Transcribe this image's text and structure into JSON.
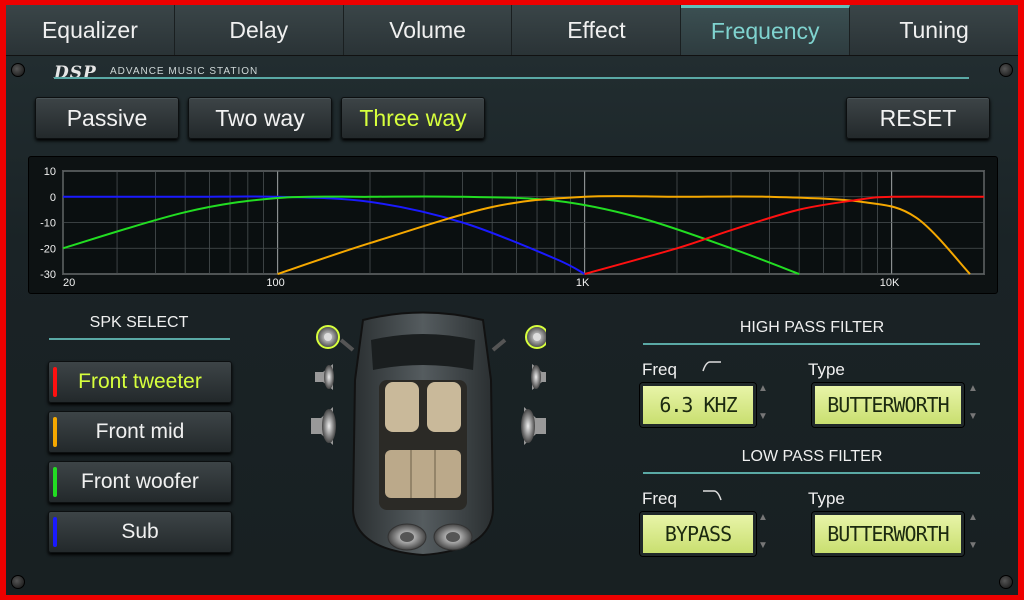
{
  "tabs": [
    {
      "label": "Equalizer",
      "active": false
    },
    {
      "label": "Delay",
      "active": false
    },
    {
      "label": "Volume",
      "active": false
    },
    {
      "label": "Effect",
      "active": false
    },
    {
      "label": "Frequency",
      "active": true
    },
    {
      "label": "Tuning",
      "active": false
    }
  ],
  "header": {
    "logo": "DSP",
    "subtitle": "ADVANCE MUSIC STATION"
  },
  "mode_buttons": {
    "passive": "Passive",
    "two_way": "Two way",
    "three_way": "Three way",
    "active": "three_way",
    "reset": "RESET"
  },
  "graph": {
    "y_ticks": [
      "10",
      "0",
      "-10",
      "-20",
      "-30"
    ],
    "x_ticks": [
      "20",
      "100",
      "1K",
      "10K"
    ]
  },
  "chart_data": {
    "type": "line",
    "x_scale": "log",
    "xlim": [
      20,
      20000
    ],
    "ylim": [
      -30,
      10
    ],
    "series": [
      {
        "color": "#1a1aff",
        "x": [
          20,
          50,
          100,
          200,
          400,
          800,
          1000
        ],
        "y": [
          0,
          0,
          0,
          -2,
          -10,
          -24,
          -30
        ]
      },
      {
        "color": "#22dd22",
        "x": [
          20,
          50,
          100,
          200,
          400,
          800,
          1500,
          3000,
          5000
        ],
        "y": [
          -20,
          -6,
          -0.5,
          0,
          0,
          -1.5,
          -8,
          -20,
          -30
        ]
      },
      {
        "color": "#f5a800",
        "x": [
          100,
          200,
          500,
          1000,
          2000,
          4000,
          8000,
          12000,
          18000
        ],
        "y": [
          -30,
          -18,
          -4,
          0,
          0,
          0,
          -2,
          -8,
          -30
        ]
      },
      {
        "color": "#ff1010",
        "x": [
          1000,
          2000,
          3000,
          5000,
          8000,
          10000,
          20000
        ],
        "y": [
          -30,
          -20,
          -13,
          -5,
          -1,
          0,
          0
        ]
      }
    ]
  },
  "spk_select": {
    "title": "SPK SELECT",
    "items": [
      {
        "label": "Front tweeter",
        "color": "#ff1010",
        "active": true
      },
      {
        "label": "Front mid",
        "color": "#f5a800",
        "active": false
      },
      {
        "label": "Front woofer",
        "color": "#22dd22",
        "active": false
      },
      {
        "label": "Sub",
        "color": "#1a1aff",
        "active": false
      }
    ]
  },
  "high_pass": {
    "title": "HIGH PASS FILTER",
    "freq_label": "Freq",
    "type_label": "Type",
    "freq_value": "6.3 KHZ",
    "type_value": "BUTTERWORTH"
  },
  "low_pass": {
    "title": "LOW PASS FILTER",
    "freq_label": "Freq",
    "type_label": "Type",
    "freq_value": "BYPASS",
    "type_value": "BUTTERWORTH"
  },
  "colors": {
    "accent": "#5fc0bb",
    "active_text": "#d7ff3d",
    "lcd": "#d9ea8a",
    "frame": "#ee0000"
  }
}
